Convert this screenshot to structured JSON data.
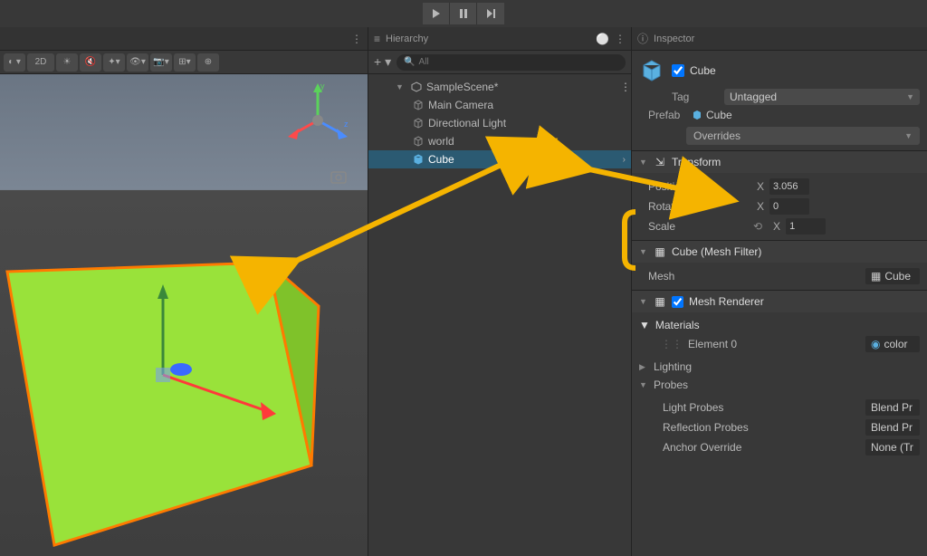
{
  "hierarchy": {
    "panel_title": "Hierarchy",
    "search_placeholder": "All",
    "scene": "SampleScene*",
    "items": [
      "Main Camera",
      "Directional Light",
      "world",
      "Cube"
    ]
  },
  "inspector": {
    "panel_title": "Inspector",
    "object_name": "Cube",
    "tag_label": "Tag",
    "tag_value": "Untagged",
    "prefab_label": "Prefab",
    "prefab_value": "Cube",
    "overrides_label": "Overrides",
    "transform": {
      "title": "Transform",
      "position_label": "Position",
      "position_x": "3.056",
      "rotation_label": "Rotation",
      "rotation_x": "0",
      "scale_label": "Scale",
      "scale_x": "1"
    },
    "mesh_filter": {
      "title": "Cube (Mesh Filter)",
      "mesh_label": "Mesh",
      "mesh_value": "Cube"
    },
    "mesh_renderer": {
      "title": "Mesh Renderer",
      "materials_label": "Materials",
      "element0_label": "Element 0",
      "element0_value": "color"
    },
    "lighting_label": "Lighting",
    "probes": {
      "title": "Probes",
      "light_probes_label": "Light Probes",
      "light_probes_value": "Blend Pr",
      "reflection_probes_label": "Reflection Probes",
      "reflection_probes_value": "Blend Pr",
      "anchor_override_label": "Anchor Override",
      "anchor_override_value": "None (Tr"
    }
  },
  "scene_toolbar": {
    "mode_2d": "2D"
  }
}
